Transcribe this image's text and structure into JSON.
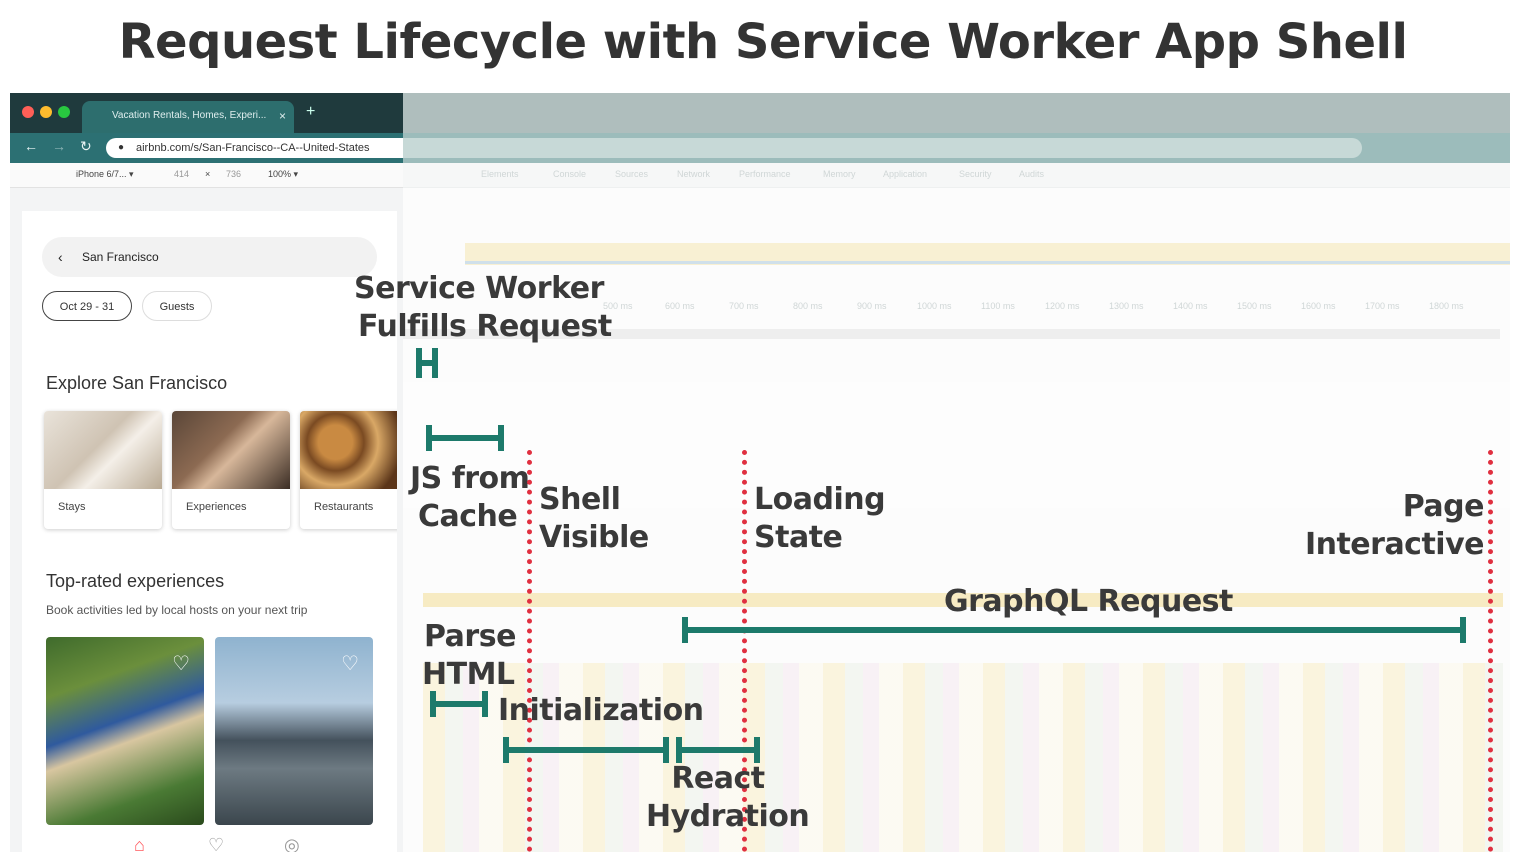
{
  "slide": {
    "title": "Request Lifecycle with Service Worker App Shell"
  },
  "browser": {
    "tab_title": "Vacation Rentals, Homes, Experi...",
    "tab_close": "×",
    "new_tab": "+",
    "url": "airbnb.com/s/San-Francisco--CA--United-States"
  },
  "device_toolbar": {
    "device": "iPhone 6/7... ▾",
    "width": "414",
    "times": "×",
    "height": "736",
    "zoom": "100% ▾"
  },
  "mobile_page": {
    "search_label": "San Francisco",
    "chips": [
      "Oct 29 - 31",
      "Guests"
    ],
    "explore_title": "Explore San Francisco",
    "categories": [
      "Stays",
      "Experiences",
      "Restaurants"
    ],
    "toprated_title": "Top-rated experiences",
    "toprated_subtitle": "Book activities led by local hosts on your next trip",
    "heart_icon": "♡"
  },
  "devtools": {
    "tabs": [
      "Elements",
      "Console",
      "Sources",
      "Network",
      "Performance",
      "Memory",
      "Application",
      "Security",
      "Audits"
    ],
    "ruler_ticks": [
      "500 ms",
      "600 ms",
      "700 ms",
      "800 ms",
      "900 ms",
      "1000 ms",
      "1100 ms",
      "1200 ms",
      "1300 ms",
      "1400 ms",
      "1500 ms",
      "1600 ms",
      "1700 ms",
      "1800 ms"
    ]
  },
  "annotations": {
    "service_worker": [
      "Service Worker",
      "Fulfills Request"
    ],
    "js_cache": [
      "JS from",
      "Cache"
    ],
    "shell_visible": [
      "Shell",
      "Visible"
    ],
    "loading_state": [
      "Loading",
      "State"
    ],
    "page_interactive": [
      "Page",
      "Interactive"
    ],
    "graphql": "GraphQL Request",
    "parse_html": [
      "Parse",
      "HTML"
    ],
    "initialization": "Initialization",
    "react_hydration": [
      "React",
      "Hydration"
    ]
  },
  "colors": {
    "bracket": "#1d7a6b",
    "marker": "#e03040",
    "tabbar": "#1f3a3d"
  }
}
